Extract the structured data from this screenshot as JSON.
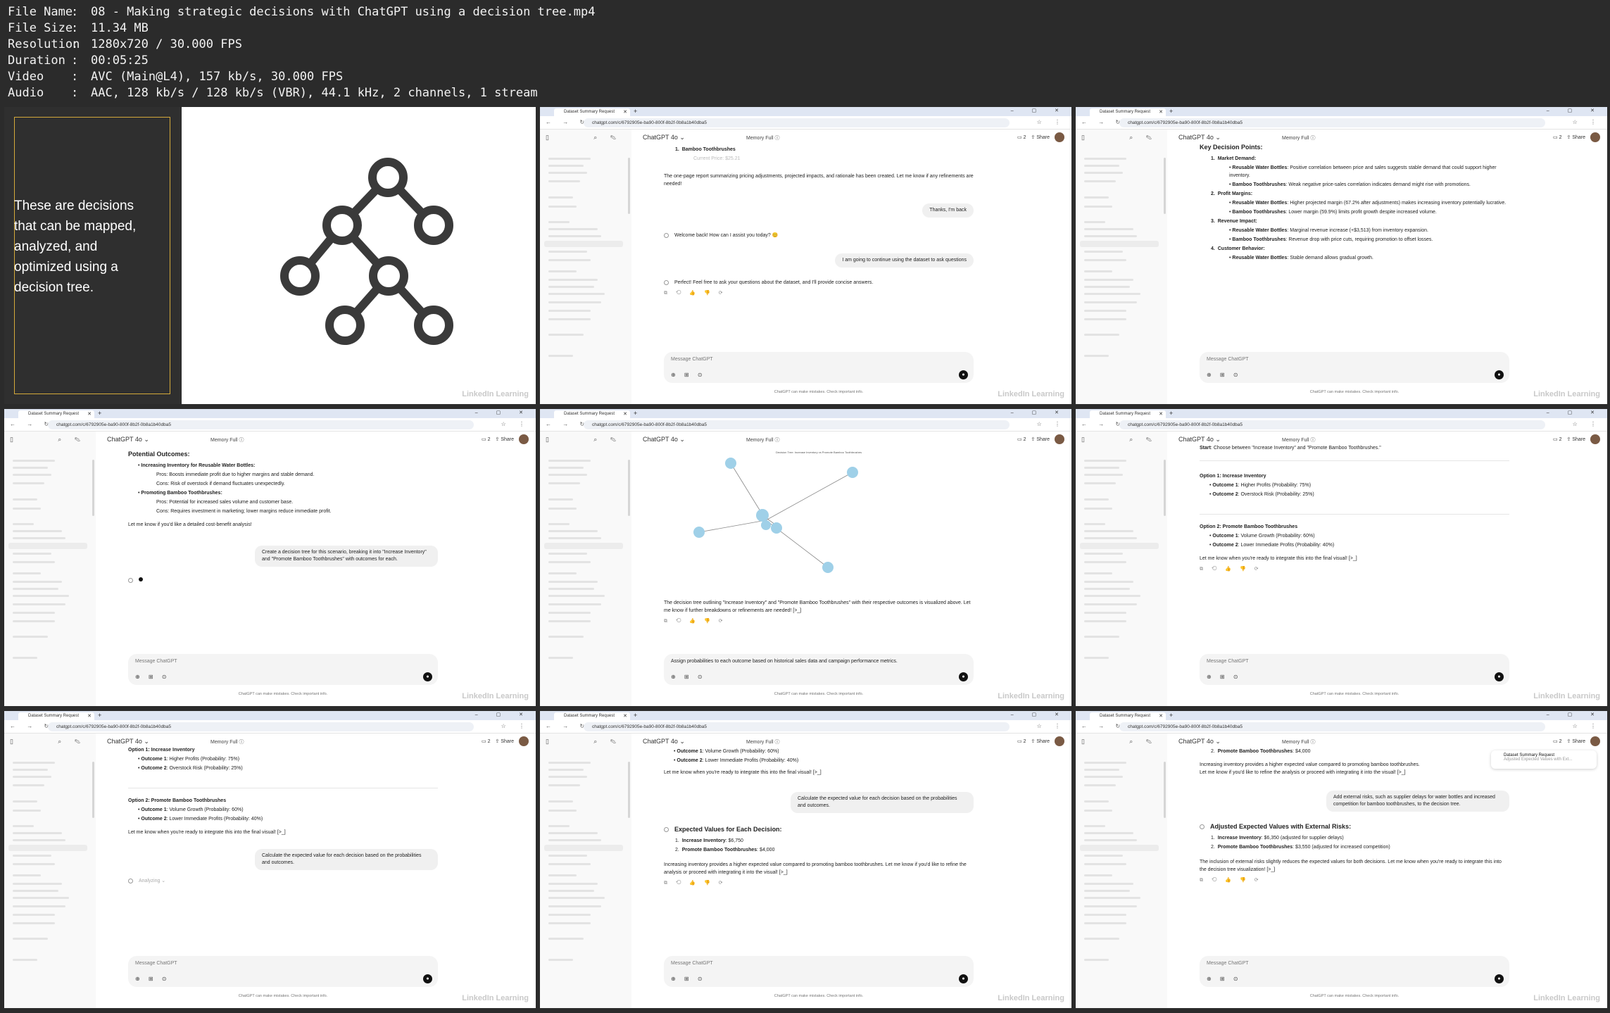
{
  "file_info": [
    {
      "key": "File Name",
      "value": "08 - Making strategic decisions with ChatGPT using a decision tree.mp4"
    },
    {
      "key": "File Size",
      "value": "11.34 MB"
    },
    {
      "key": "Resolution",
      "value": "1280x720 / 30.000 FPS"
    },
    {
      "key": "Duration",
      "value": "00:05:25"
    },
    {
      "key": "Video",
      "value": "AVC (Main@L4), 157 kb/s, 30.000 FPS"
    },
    {
      "key": "Audio",
      "value": "AAC, 128 kb/s / 128 kb/s (VBR), 44.1 kHz, 2 channels, 1 stream"
    }
  ],
  "info_sep": ":",
  "slide": {
    "text": "These are decisions that can be mapped, analyzed, and optimized using a decision tree.",
    "watermark": "LinkedIn Learning"
  },
  "browser": {
    "tab_title": "Dataset Summary Request",
    "url": "chatgpt.com/c/6792905e-ba90-800f-8b2f-0b8a1b40dba5",
    "model": "ChatGPT 4o",
    "memory": "Memory Full",
    "share": "Share",
    "conv_count": "2",
    "composer_placeholder": "Message ChatGPT",
    "disclaimer": "ChatGPT can make mistakes. Check important info."
  },
  "t2": {
    "item": "Bamboo Toothbrushes",
    "sub": "Current Price: $25.21",
    "msg1": "The one-page report summarizing pricing adjustments, projected impacts, and rationale has been created. Let me know if any refinements are needed!",
    "user1": "Thanks, I'm back",
    "msg2": "Welcome back! How can I assist you today? 😊",
    "user2": "I am going to continue using the dataset to ask questions",
    "msg3": "Perfect! Feel free to ask your questions about the dataset, and I'll provide concise answers."
  },
  "t3": {
    "heading": "Key Decision Points:",
    "s1": "Market Demand:",
    "s1a_b": "Reusable Water Bottles",
    "s1a": ": Positive correlation between price and sales suggests stable demand that could support higher inventory.",
    "s1b_b": "Bamboo Toothbrushes",
    "s1b": ": Weak negative price-sales correlation indicates demand might rise with promotions.",
    "s2": "Profit Margins:",
    "s2a_b": "Reusable Water Bottles",
    "s2a": ": Higher projected margin (67.2% after adjustments) makes increasing inventory potentially lucrative.",
    "s2b_b": "Bamboo Toothbrushes",
    "s2b": ": Lower margin (59.9%) limits profit growth despite increased volume.",
    "s3": "Revenue Impact:",
    "s3a_b": "Reusable Water Bottles",
    "s3a": ": Marginal revenue increase (+$3,513) from inventory expansion.",
    "s3b_b": "Bamboo Toothbrushes",
    "s3b": ": Revenue drop with price cuts, requiring promotion to offset losses.",
    "s4": "Customer Behavior:",
    "s4a_b": "Reusable Water Bottles",
    "s4a": ": Stable demand allows gradual growth."
  },
  "t4": {
    "heading": "Potential Outcomes:",
    "o1": "Increasing Inventory for Reusable Water Bottles:",
    "o1a": "Pros: Boosts immediate profit due to higher margins and stable demand.",
    "o1b": "Cons: Risk of overstock if demand fluctuates unexpectedly.",
    "o2": "Promoting Bamboo Toothbrushes:",
    "o2a": "Pros: Potential for increased sales volume and customer base.",
    "o2b": "Cons: Requires investment in marketing; lower margins reduce immediate profit.",
    "closing": "Let me know if you'd like a detailed cost-benefit analysis!",
    "user": "Create a decision tree for this scenario, breaking it into \"Increase Inventory\" and \"Promote Bamboo Toothbrushes\" with outcomes for each."
  },
  "t5": {
    "chart_title": "Decision Tree: Increase Inventory vs Promote Bamboo Toothbrushes",
    "msg": "The decision tree outlining \"Increase Inventory\" and \"Promote Bamboo Toothbrushes\" with their respective outcomes is visualized above. Let me know if further breakdowns or refinements are needed! [>_]",
    "composer_text": "Assign probabilities to each outcome based on historical sales data and campaign performance metrics."
  },
  "t6": {
    "start_b": "Start",
    "start": ": Choose between \"Increase Inventory\" and \"Promote Bamboo Toothbrushes.\"",
    "opt1": "Option 1: Increase Inventory",
    "opt1a_b": "Outcome 1",
    "opt1a": ": Higher Profits (Probability: 75%)",
    "opt1b_b": "Outcome 2",
    "opt1b": ": Overstock Risk (Probability: 25%)",
    "opt2": "Option 2: Promote Bamboo Toothbrushes",
    "opt2a_b": "Outcome 1",
    "opt2a": ": Volume Growth (Probability: 60%)",
    "opt2b_b": "Outcome 2",
    "opt2b": ": Lower Immediate Profits (Probability: 40%)",
    "closing": "Let me know when you're ready to integrate this into the final visual! [>_]"
  },
  "t7": {
    "user": "Calculate the expected value for each decision based on the probabilities and outcomes.",
    "status": "Analyzing"
  },
  "t8": {
    "top1_b": "Outcome 1",
    "top1": ": Volume Growth (Probability: 60%)",
    "top2_b": "Outcome 2",
    "top2": ": Lower Immediate Profits (Probability: 40%)",
    "heading": "Expected Values for Each Decision:",
    "ev1_b": "Increase Inventory",
    "ev1": ": $6,750",
    "ev2_b": "Promote Bamboo Toothbrushes",
    "ev2": ": $4,000",
    "msg": "Increasing inventory provides a higher expected value compared to promoting bamboo toothbrushes. Let me know if you'd like to refine the analysis or proceed with integrating it into the visual! [>_]"
  },
  "t9": {
    "top_b": "Promote Bamboo Toothbrushes",
    "top": ": $4,000",
    "msg1": "Increasing inventory provides a higher expected value compared to promoting bamboo toothbrushes. Let me know if you'd like to refine the analysis or proceed with integrating it into the visual! [>_]",
    "user": "Add external risks, such as supplier delays for water bottles and increased competition for bamboo toothbrushes, to the decision tree.",
    "heading": "Adjusted Expected Values with External Risks:",
    "ev1_b": "Increase Inventory",
    "ev1": ": $6,350 (adjusted for supplier delays)",
    "ev2_b": "Promote Bamboo Toothbrushes",
    "ev2": ": $3,550 (adjusted for increased competition)",
    "msg2": "The inclusion of external risks slightly reduces the expected values for both decisions. Let me know when you're ready to integrate this into the decision tree visualization! [>_]",
    "popup_title": "Dataset Summary Request",
    "popup_sub": "Adjusted Expected Values with Ext..."
  },
  "colors": {
    "accent": "#d4a93a",
    "node": "#9fd0e8",
    "tree": "#3a3a3a"
  }
}
